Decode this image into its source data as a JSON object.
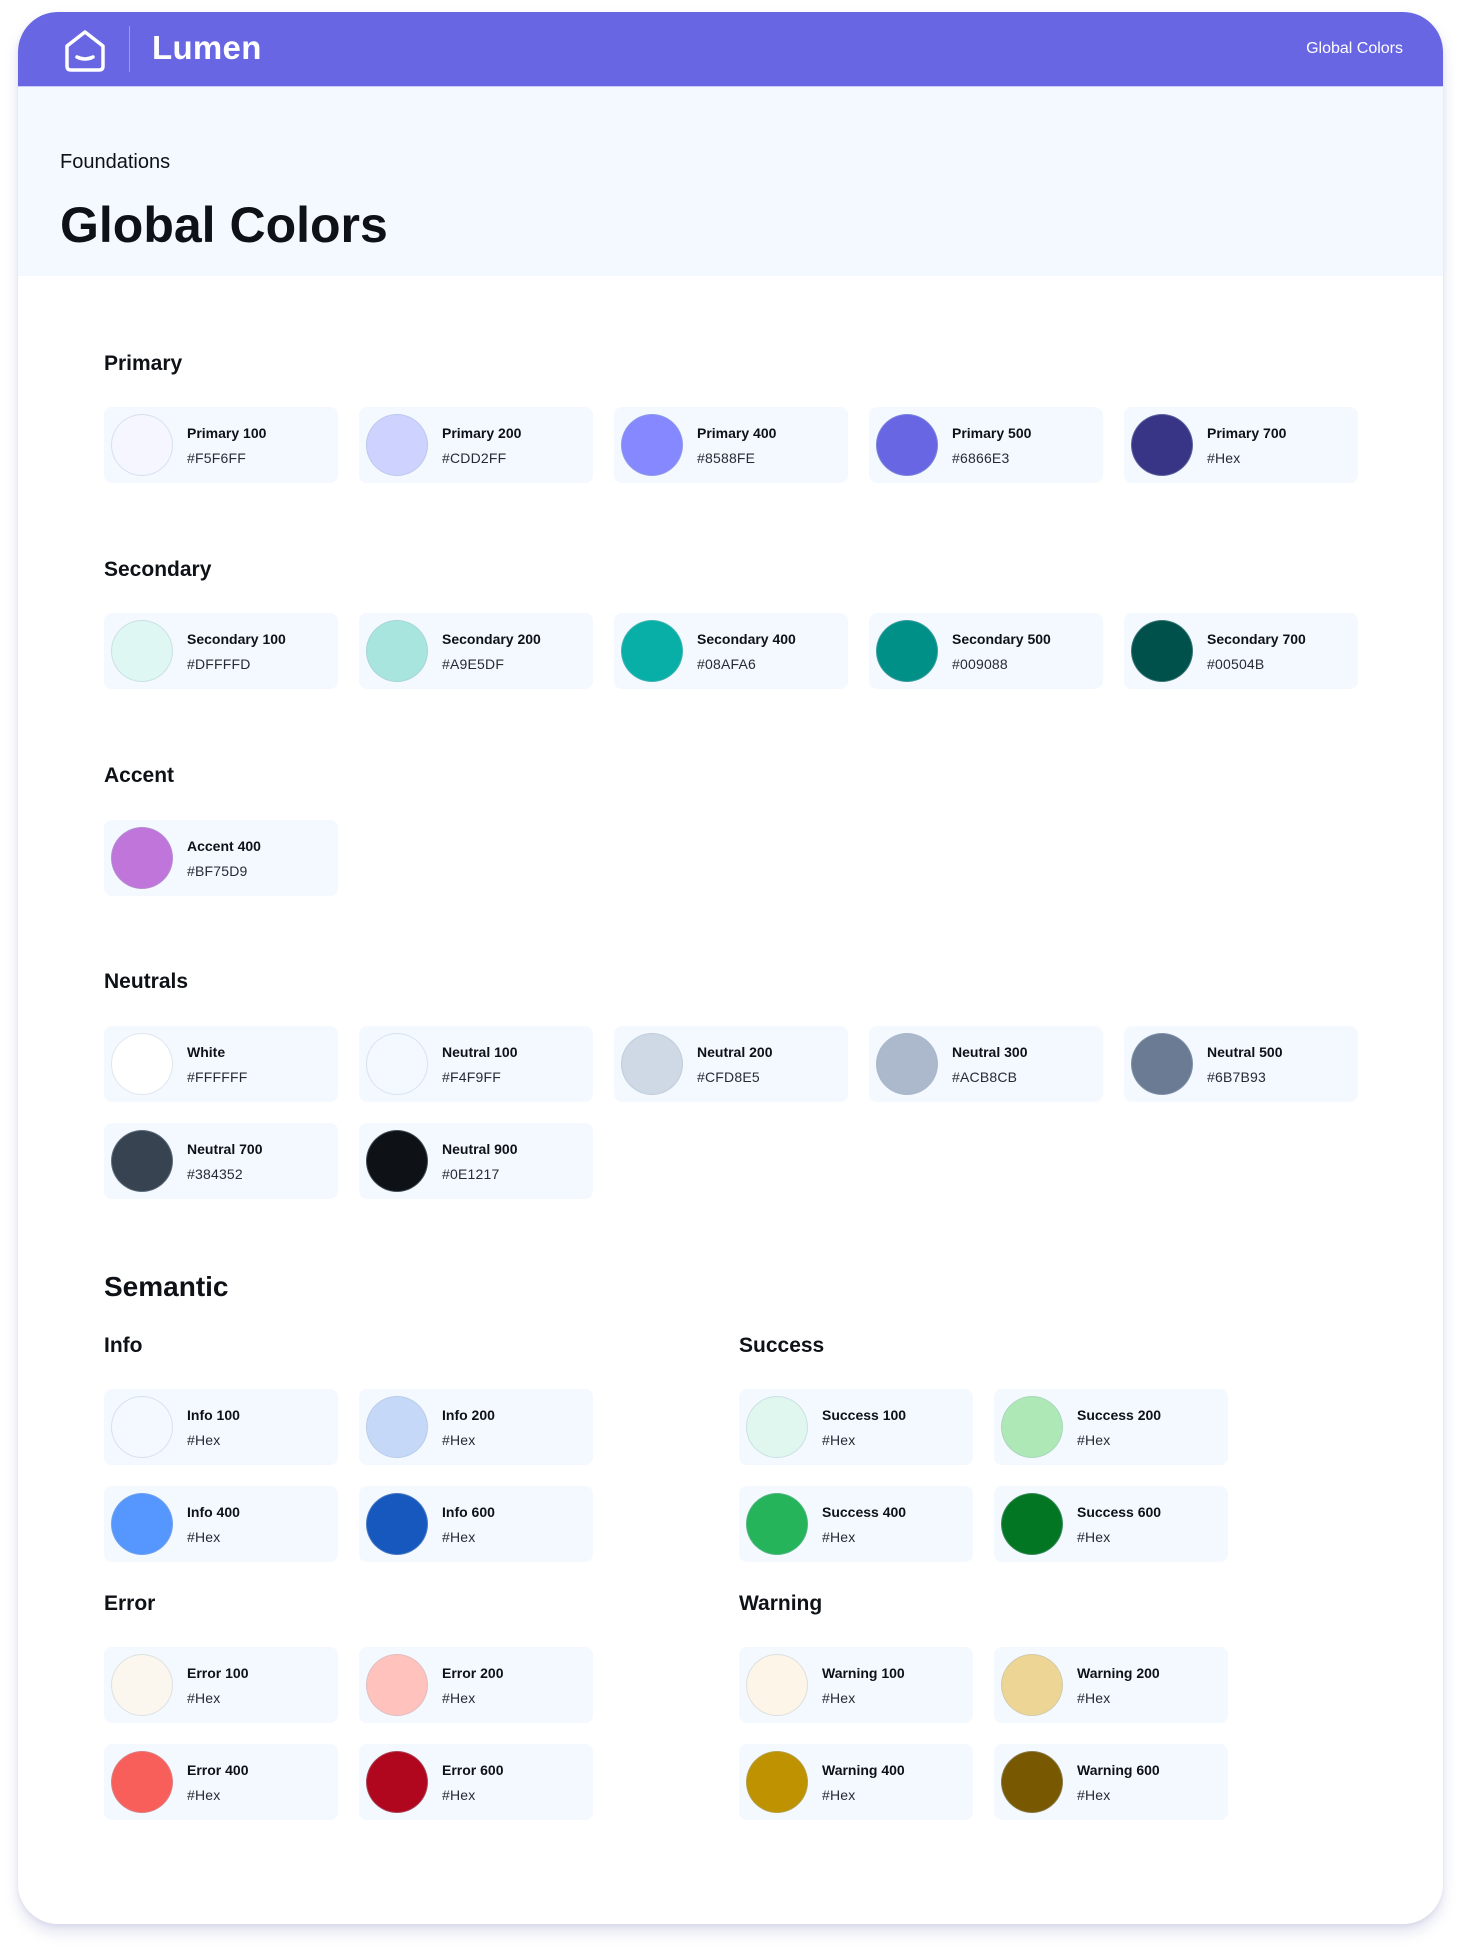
{
  "header": {
    "brand": "Lumen",
    "nav_link": "Global Colors",
    "logo_icon": "house-smile-icon",
    "bar_color": "#6866E3"
  },
  "hero": {
    "eyebrow": "Foundations",
    "title": "Global Colors"
  },
  "sections": [
    {
      "title": "Primary",
      "swatches": [
        {
          "name": "Primary 100",
          "hex": "#F5F6FF",
          "color": "#F5F6FF"
        },
        {
          "name": "Primary 200",
          "hex": "#CDD2FF",
          "color": "#CDD2FF"
        },
        {
          "name": "Primary 400",
          "hex": "#8588FE",
          "color": "#8588FE"
        },
        {
          "name": "Primary 500",
          "hex": "#6866E3",
          "color": "#6866E3"
        },
        {
          "name": "Primary 700",
          "hex": "#Hex",
          "color": "#383586"
        }
      ]
    },
    {
      "title": "Secondary",
      "swatches": [
        {
          "name": "Secondary 100",
          "hex": "#DFFFFD",
          "color": "#DFF7F2"
        },
        {
          "name": "Secondary 200",
          "hex": "#A9E5DF",
          "color": "#A9E5DF"
        },
        {
          "name": "Secondary 400",
          "hex": "#08AFA6",
          "color": "#08AFA6"
        },
        {
          "name": "Secondary 500",
          "hex": "#009088",
          "color": "#009088"
        },
        {
          "name": "Secondary 700",
          "hex": "#00504B",
          "color": "#00504B"
        }
      ]
    },
    {
      "title": "Accent",
      "swatches": [
        {
          "name": "Accent 400",
          "hex": "#BF75D9",
          "color": "#BF75D9"
        }
      ]
    },
    {
      "title": "Neutrals",
      "swatches": [
        {
          "name": "White",
          "hex": "#FFFFFF",
          "color": "#FFFFFF"
        },
        {
          "name": "Neutral 100",
          "hex": "#F4F9FF",
          "color": "#F4F9FF"
        },
        {
          "name": "Neutral 200",
          "hex": "#CFD8E5",
          "color": "#CFD8E5"
        },
        {
          "name": "Neutral 300",
          "hex": "#ACB8CB",
          "color": "#ACB8CB"
        },
        {
          "name": "Neutral 500",
          "hex": "#6B7B93",
          "color": "#6B7B93"
        },
        {
          "name": "Neutral 700",
          "hex": "#384352",
          "color": "#384352"
        },
        {
          "name": "Neutral 900",
          "hex": "#0E1217",
          "color": "#0E1217"
        }
      ]
    }
  ],
  "semantic": {
    "title": "Semantic",
    "groups": [
      {
        "title": "Info",
        "swatches": [
          {
            "name": "Info 100",
            "hex": "#Hex",
            "color": "#F4F8FF"
          },
          {
            "name": "Info 200",
            "hex": "#Hex",
            "color": "#C6D8F8"
          },
          {
            "name": "Info 400",
            "hex": "#Hex",
            "color": "#5596FF"
          },
          {
            "name": "Info 600",
            "hex": "#Hex",
            "color": "#1758BE"
          }
        ]
      },
      {
        "title": "Success",
        "swatches": [
          {
            "name": "Success 100",
            "hex": "#Hex",
            "color": "#E0F7F0"
          },
          {
            "name": "Success 200",
            "hex": "#Hex",
            "color": "#AEE8B6"
          },
          {
            "name": "Success 400",
            "hex": "#Hex",
            "color": "#26B45A"
          },
          {
            "name": "Success 600",
            "hex": "#Hex",
            "color": "#027623"
          }
        ]
      },
      {
        "title": "Error",
        "swatches": [
          {
            "name": "Error 100",
            "hex": "#Hex",
            "color": "#FCF7EE"
          },
          {
            "name": "Error 200",
            "hex": "#Hex",
            "color": "#FFC2BC"
          },
          {
            "name": "Error 400",
            "hex": "#Hex",
            "color": "#F95F5A"
          },
          {
            "name": "Error 600",
            "hex": "#Hex",
            "color": "#B0071E"
          }
        ]
      },
      {
        "title": "Warning",
        "swatches": [
          {
            "name": "Warning 100",
            "hex": "#Hex",
            "color": "#FDF5E8"
          },
          {
            "name": "Warning 200",
            "hex": "#Hex",
            "color": "#EDD595"
          },
          {
            "name": "Warning 400",
            "hex": "#Hex",
            "color": "#BE9200"
          },
          {
            "name": "Warning 600",
            "hex": "#Hex",
            "color": "#785800"
          }
        ]
      }
    ]
  }
}
